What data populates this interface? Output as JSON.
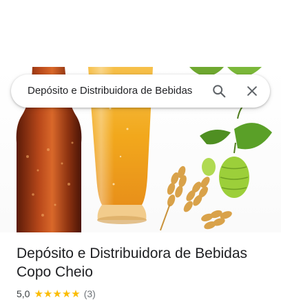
{
  "search": {
    "query": "Depósito e Distribuidora de Bebidas",
    "search_icon": "search-icon",
    "close_icon": "close-icon"
  },
  "hero_image": {
    "subject": "beer-bottle-glass-wheat-hops-photo"
  },
  "place": {
    "title_line1": "Depósito e Distribuidora de Bebidas",
    "title_line2": "Copo Cheio",
    "rating": "5,0",
    "stars": 5,
    "review_count": "(3)"
  },
  "colors": {
    "star": "#fbbc04",
    "title": "#202124",
    "secondary_text": "#70757a"
  }
}
